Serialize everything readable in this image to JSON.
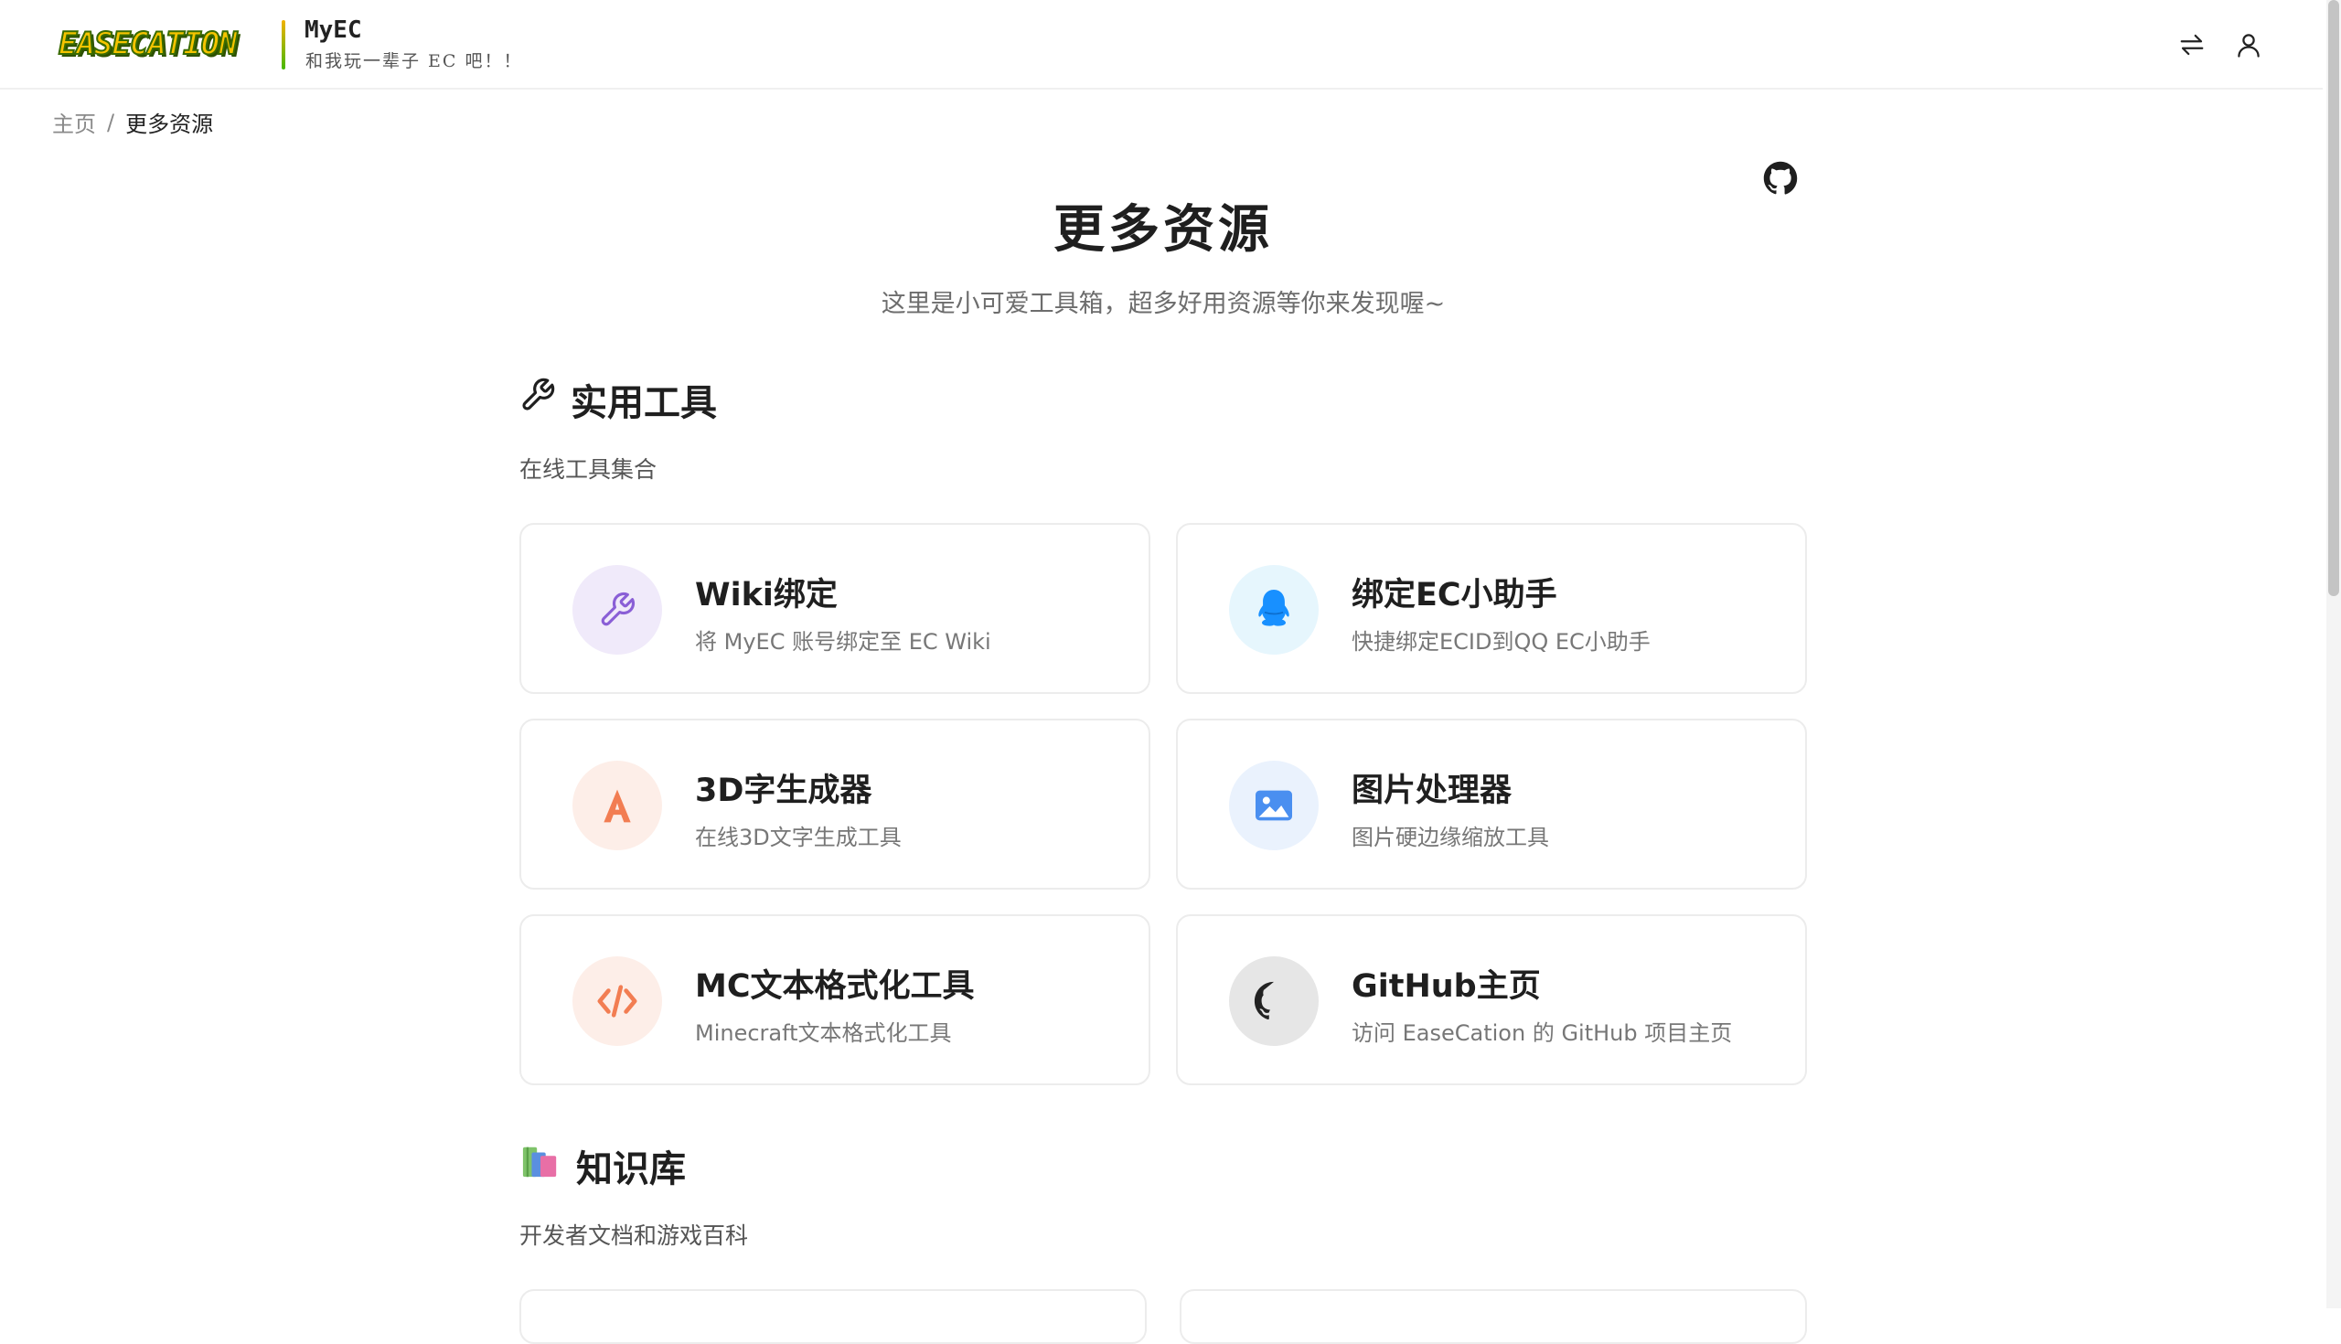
{
  "header": {
    "logo_text": "EASECATION",
    "brand_title": "MyEC",
    "brand_subtitle": "和我玩一辈子 EC 吧！！",
    "switch_icon": "swap-arrows-icon",
    "user_icon": "user-icon"
  },
  "breadcrumb": {
    "home": "主页",
    "separator": "/",
    "current": "更多资源"
  },
  "page": {
    "title": "更多资源",
    "subtitle": "这里是小可爱工具箱，超多好用资源等你来发现喔~",
    "github_icon": "github-icon"
  },
  "sections": {
    "tools": {
      "title": "实用工具",
      "icon": "wrench-icon",
      "desc": "在线工具集合",
      "cards": [
        {
          "title": "Wiki绑定",
          "desc": "将 MyEC 账号绑定至 EC Wiki",
          "icon": "wrench-icon",
          "color": "#8a5fd6",
          "bg": "#f0eafa"
        },
        {
          "title": "绑定EC小助手",
          "desc": "快捷绑定ECID到QQ EC小助手",
          "icon": "qq-icon",
          "color": "#1890ff",
          "bg": "#e6f6fd"
        },
        {
          "title": "3D字生成器",
          "desc": "在线3D文字生成工具",
          "icon": "font-a-icon",
          "color": "#f27d52",
          "bg": "#fdeee8"
        },
        {
          "title": "图片处理器",
          "desc": "图片硬边缘缩放工具",
          "icon": "image-icon",
          "color": "#4a8ff0",
          "bg": "#eaf2fd"
        },
        {
          "title": "MC文本格式化工具",
          "desc": "Minecraft文本格式化工具",
          "icon": "code-icon",
          "color": "#f27d52",
          "bg": "#fdeee8"
        },
        {
          "title": "GitHub主页",
          "desc": "访问 EaseCation 的 GitHub 项目主页",
          "icon": "github-icon",
          "color": "#222222",
          "bg": "#e6e6e6"
        }
      ]
    },
    "knowledge": {
      "title": "知识库",
      "icon": "books-icon",
      "desc": "开发者文档和游戏百科"
    }
  }
}
